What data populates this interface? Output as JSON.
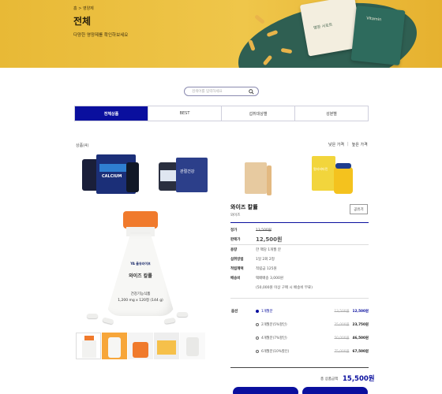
{
  "hero": {
    "breadcrumb": "홈 > 영양제",
    "title": "전체",
    "subtitle": "다양한 영양제를 확인하보세요",
    "pack_left_text": "영양 서포트",
    "pack_right_text": "Vitamin"
  },
  "search": {
    "placeholder": "검색어를 입력하세요"
  },
  "tabs": [
    {
      "label": "전체상품",
      "active": true
    },
    {
      "label": "BEST",
      "active": false
    },
    {
      "label": "섭취대상별",
      "active": false
    },
    {
      "label": "성분별",
      "active": false
    }
  ],
  "list": {
    "count": "상품(4)",
    "sort_low": "낮은 가격",
    "sort_sep": "|",
    "sort_high": "높은 가격"
  },
  "thumbs": [
    {
      "text": "CALCIUM"
    },
    {
      "text": "관절건강"
    },
    {
      "text": ""
    },
    {
      "text": "멀티비타민"
    }
  ],
  "main_image": {
    "brand": "YA 율유라이프",
    "name": "와이즈 칼률",
    "caption": "건강기능식품",
    "dose": "1,200 mg x 120정 (144 g)"
  },
  "product": {
    "name": "와이즈 칼률",
    "brand": "와이즈",
    "share": "공유기",
    "rows": [
      {
        "key": "정가",
        "value": "13,500원",
        "style": "strike"
      },
      {
        "key": "판매가",
        "value": "12,500원",
        "style": "sale"
      },
      {
        "key": "용량",
        "value": "한 팩당 1개월 분",
        "style": ""
      },
      {
        "key": "섭취방법",
        "value": "1일 2회 2정",
        "style": ""
      },
      {
        "key": "적립혜택",
        "value": "적립금 125원",
        "style": ""
      },
      {
        "key": "배송비",
        "value": "택배배송 3,000원",
        "style": ""
      },
      {
        "key": "",
        "value": "(50,000원 이상 구매 시 배송비 무료)",
        "style": ""
      }
    ]
  },
  "options": {
    "label": "옵션",
    "items": [
      {
        "name": "1개월분",
        "old": "13,500원",
        "new": "12,500원",
        "selected": true
      },
      {
        "name": "2개월분(5%할인)",
        "old": "25,000원",
        "new": "23,750원",
        "selected": false
      },
      {
        "name": "4개월분(7%할인)",
        "old": "50,000원",
        "new": "46,500원",
        "selected": false
      },
      {
        "name": "6개월분(10%할인)",
        "old": "75,000원",
        "new": "67,500원",
        "selected": false
      }
    ]
  },
  "total": {
    "label": "총 상품금액",
    "value": "15,500원"
  },
  "colors": {
    "accent": "#0a0f9e",
    "hero_bg": "#efc64a",
    "cap_orange": "#f07a2c"
  }
}
